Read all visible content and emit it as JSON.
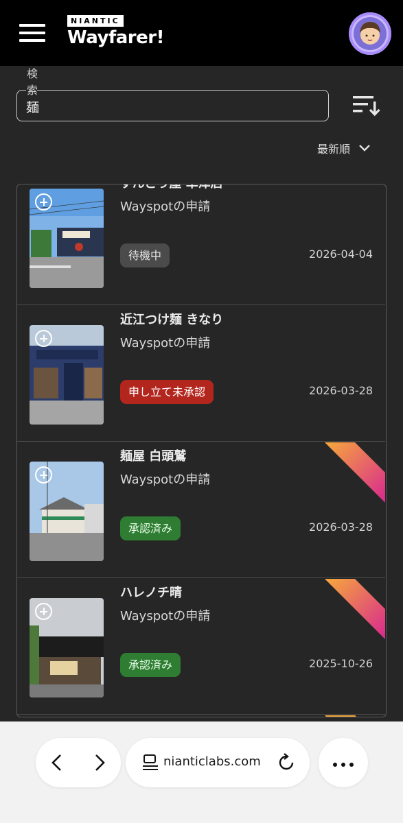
{
  "header": {
    "logo_top": "NIANTIC",
    "logo_word": "Wayfarer",
    "logo_mark": "!",
    "menu_icon": "hamburger-menu-icon",
    "avatar_icon": "user-avatar-icon"
  },
  "search": {
    "label": "検索",
    "value": "麺",
    "sort_icon": "sort-descending-icon"
  },
  "order": {
    "selected": "最新順",
    "icon": "chevron-down-icon"
  },
  "nominations": [
    {
      "title": "ずんどう屋 草津店",
      "type": "Wayspotの申請",
      "status": "待機中",
      "status_kind": "waiting",
      "date": "2026-04-04",
      "ribbon": false
    },
    {
      "title": "近江つけ麺 きなり",
      "type": "Wayspotの申請",
      "status": "申し立て未承認",
      "status_kind": "appeal",
      "date": "2026-03-28",
      "ribbon": false
    },
    {
      "title": "麺屋 白頭鷲",
      "type": "Wayspotの申請",
      "status": "承認済み",
      "status_kind": "accepted",
      "date": "2026-03-28",
      "ribbon": true
    },
    {
      "title": "ハレノチ晴",
      "type": "Wayspotの申請",
      "status": "承認済み",
      "status_kind": "accepted",
      "date": "2025-10-26",
      "ribbon": true
    }
  ],
  "colors": {
    "accepted": "#2e7d32",
    "appeal": "#b3261e",
    "waiting": "#4b4b4b",
    "ribbon_start": "#f6a93b",
    "ribbon_end": "#d8288f"
  },
  "browser": {
    "url": "nianticlabs.com",
    "back_icon": "back-arrow-icon",
    "forward_icon": "forward-arrow-icon",
    "tabs_icon": "reader-icon",
    "reload_icon": "reload-icon",
    "more_icon": "more-dots-icon"
  }
}
